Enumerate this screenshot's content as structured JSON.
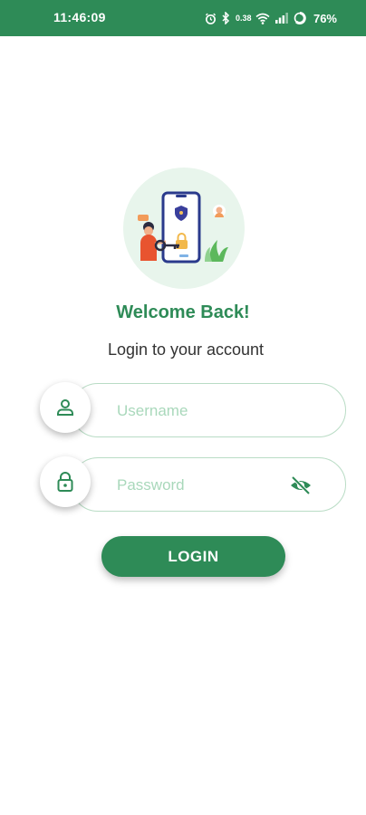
{
  "status_bar": {
    "time": "11:46:09",
    "network_speed": "0.38",
    "battery": "76%",
    "icons": [
      "alarm-icon",
      "bluetooth-icon",
      "wifi-icon",
      "signal-icon",
      "battery-icon"
    ]
  },
  "login": {
    "title": "Welcome Back!",
    "subtitle": "Login to your account",
    "username_placeholder": "Username",
    "password_placeholder": "Password",
    "login_label": "LOGIN"
  },
  "colors": {
    "primary": "#2e8b57",
    "field_border": "#b9dcc5",
    "hero_background": "#e8f5ec"
  }
}
